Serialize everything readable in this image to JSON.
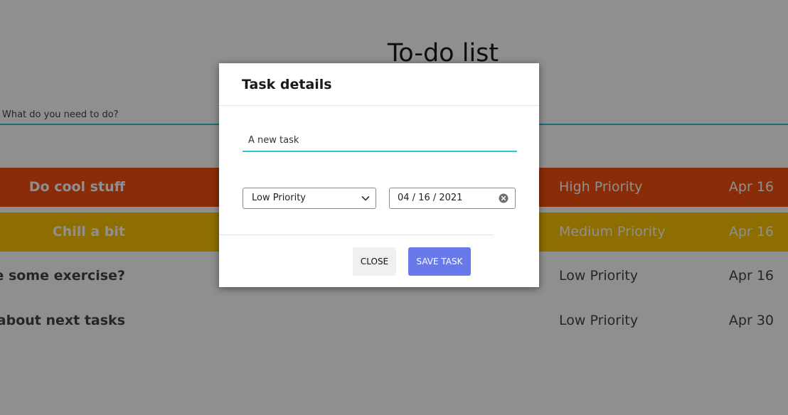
{
  "page": {
    "title": "To-do list"
  },
  "new_task": {
    "placeholder": "What do you need to do?"
  },
  "tasks": [
    {
      "title": "Do cool stuff",
      "priority": "High Priority",
      "date": "Apr 16",
      "color": "#f44f0e",
      "text_color": "#ffffff"
    },
    {
      "title": "Chill a bit",
      "priority": "Medium Priority",
      "date": "Apr 16",
      "color": "#fdc500",
      "text_color": "#ffffff"
    },
    {
      "title": "Maybe some exercise?",
      "priority": "Low Priority",
      "date": "Apr 16",
      "color": "#ffffff",
      "text_color": "#444444"
    },
    {
      "title": "Think about next tasks",
      "priority": "Low Priority",
      "date": "Apr 30",
      "color": "#ffffff",
      "text_color": "#444444"
    }
  ],
  "modal": {
    "title": "Task details",
    "task_text": "A new task",
    "priority_selected": "Low Priority",
    "date_value": "04 / 16 / 2021",
    "close_label": "Close",
    "save_label": "Save task"
  },
  "colors": {
    "accent_underline": "#26c6da",
    "save_button": "#6a79ea",
    "high_priority": "#f44f0e",
    "medium_priority": "#fdc500"
  },
  "icons": {
    "select_arrow": "chevron-down-icon",
    "date_clear": "clear-icon"
  }
}
